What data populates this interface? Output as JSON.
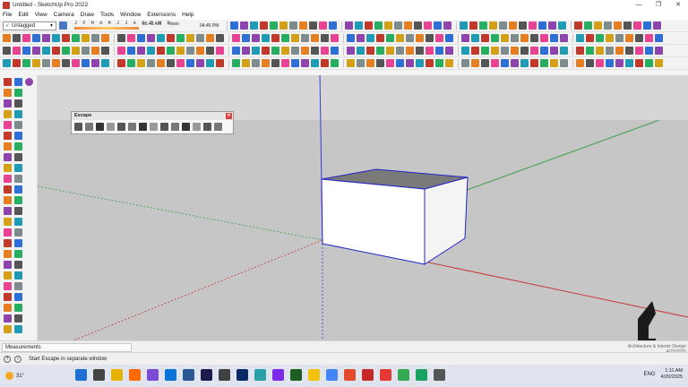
{
  "window": {
    "title": "Untitled - SketchUp Pro 2022",
    "controls": [
      "—",
      "❐",
      "✕"
    ]
  },
  "menubar": [
    "File",
    "Edit",
    "View",
    "Camera",
    "Draw",
    "Tools",
    "Window",
    "Extensions",
    "Help"
  ],
  "toolbar": {
    "tag_selector": "Untagged",
    "shadow_months": "J F M A M J J A S O N D",
    "shadow_time_start": "06:43 AM",
    "shadow_time_noon": "Noon",
    "shadow_time_end": "04:45 PM"
  },
  "escape_panel": {
    "title": "Escape",
    "close": "✕"
  },
  "measurements": {
    "label": "Measurements"
  },
  "statusbar": {
    "text": "Start Escape in separate window"
  },
  "watermark": {
    "line1": "Architecture & Interior Design",
    "date": "4/20/2025"
  },
  "taskbar": {
    "temperature": "31°",
    "language": "ENG",
    "time": "1:11 AM",
    "date": "4/20/2025"
  },
  "colors": {
    "axis_blue": "#2d3fd6",
    "axis_green": "#3fa34d",
    "axis_red": "#c43c3c",
    "sky": "#d4d4d4",
    "ground": "#c4c4c4",
    "box_edge": "#2222c8",
    "box_top": "#7a7a7a"
  }
}
